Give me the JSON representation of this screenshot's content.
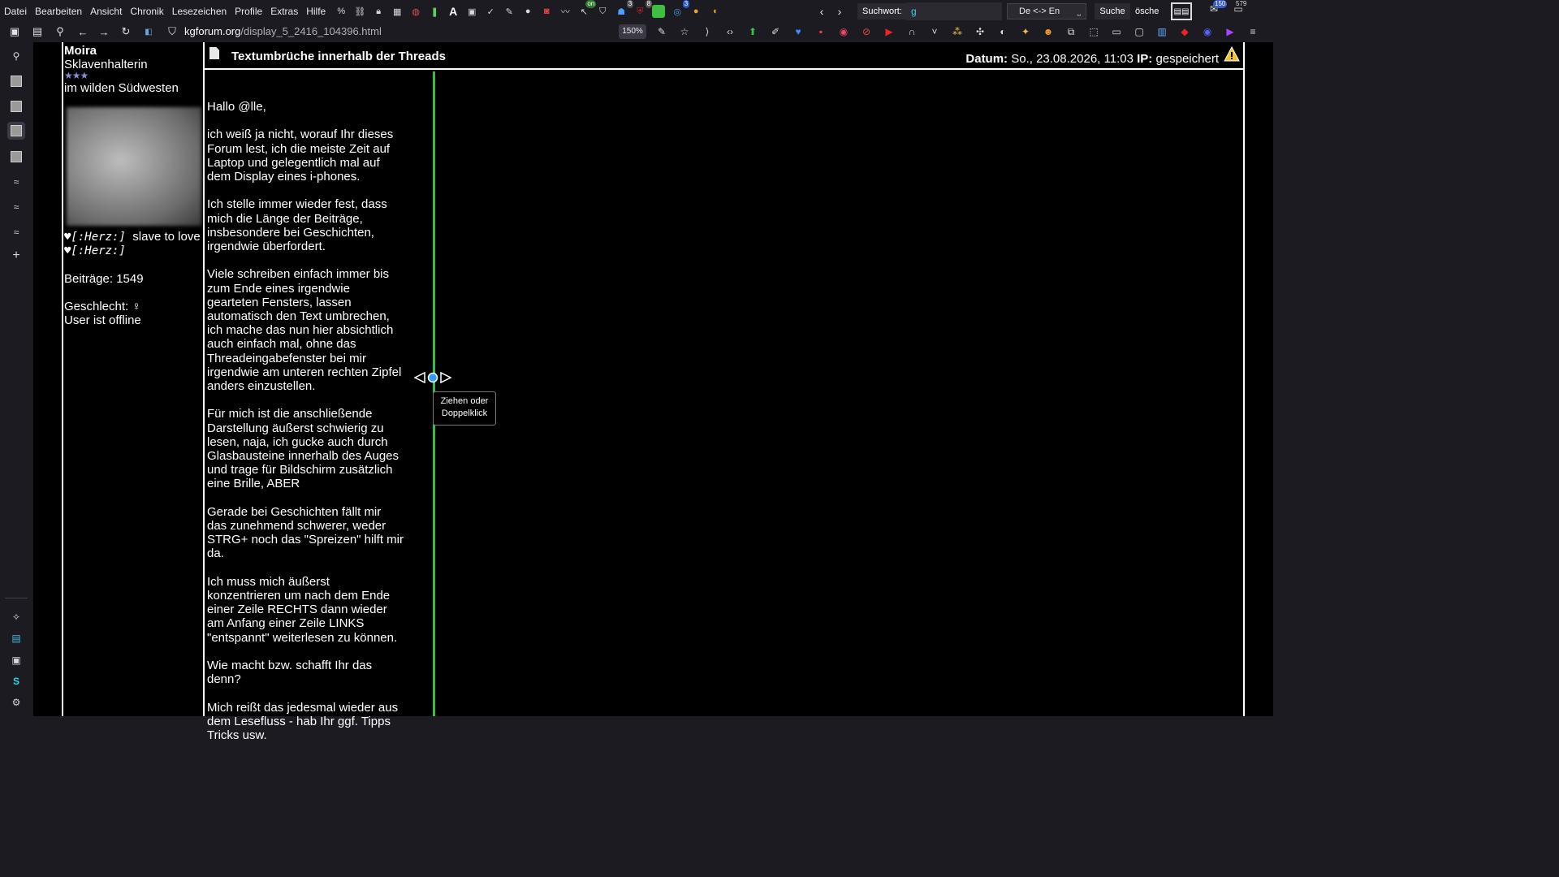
{
  "menu": [
    "Datei",
    "Bearbeiten",
    "Ansicht",
    "Chronik",
    "Lesezeichen",
    "Profile",
    "Extras",
    "Hilfe"
  ],
  "toolbar": {
    "percent_label": "%",
    "a_label": "A",
    "badge_on": "on",
    "badge_3a": "3",
    "badge_8": "8",
    "badge_3b": "3",
    "search_label": "Suchwort:",
    "search_value": "g",
    "lang_select": "De <-> En",
    "search_button": "Suche",
    "delete_button": "ösche",
    "badge_150": "150",
    "badge_579": "579"
  },
  "navbar": {
    "url_host": "kgforum.org",
    "url_path": "/display_5_2416_104396.html",
    "zoom": "150%"
  },
  "author": {
    "name": "Moira",
    "rank": "Sklavenhalterin",
    "stars": "★★★",
    "location": "im wilden Südwesten",
    "sig_line1_code": "♥[:Herz:]",
    "sig_line1_text": "slave to love",
    "sig_line2_code": "♥[:Herz:]",
    "posts": "Beiträge: 1549",
    "gender": "Geschlecht: ♀",
    "status": "User ist offline"
  },
  "post": {
    "title": "Textumbrüche innerhalb der Threads",
    "date_label": "Datum:",
    "date_value": "So., 23.08.2026, 11:03",
    "ip_label": "IP:",
    "ip_value": "gespeichert",
    "paragraphs": [
      "Hallo @lle,",
      "ich weiß ja nicht, worauf Ihr dieses Forum lest, ich die meiste Zeit auf Laptop und gelegentlich mal auf dem Display eines i-phones.",
      "Ich stelle immer wieder fest, dass mich die Länge der Beiträge, insbesondere bei Geschichten, irgendwie überfordert.",
      "Viele schreiben einfach immer bis zum Ende eines irgendwie gearteten Fensters, lassen automatisch den Text umbrechen, ich mache das nun hier absichtlich auch einfach mal, ohne das Threadeingabefenster bei mir irgendwie am unteren rechten Zipfel anders einzustellen.",
      "Für mich ist die anschließende Darstellung äußerst schwierig zu lesen, naja, ich gucke auch durch Glasbausteine innerhalb des Auges und trage für Bildschirm zusätzlich eine Brille, ABER",
      "Gerade bei Geschichten fällt mir das zunehmend schwerer, weder STRG+ noch das \"Spreizen\" hilft mir da.",
      "Ich muss mich äußerst konzentrieren um nach dem Ende einer Zeile RECHTS dann wieder am Anfang einer Zeile LINKS \"entspannt\" weiterlesen zu können.",
      "Wie macht bzw. schafft Ihr das denn?",
      "Mich reißt das jedesmal wieder aus dem Lesefluss - hab Ihr ggf. Tipps Tricks usw."
    ]
  },
  "tooltip": {
    "line1": "Ziehen oder",
    "line2": "Doppelklick"
  },
  "colors": {
    "divider": "#2fc13d",
    "handle": "#2f9bff"
  }
}
